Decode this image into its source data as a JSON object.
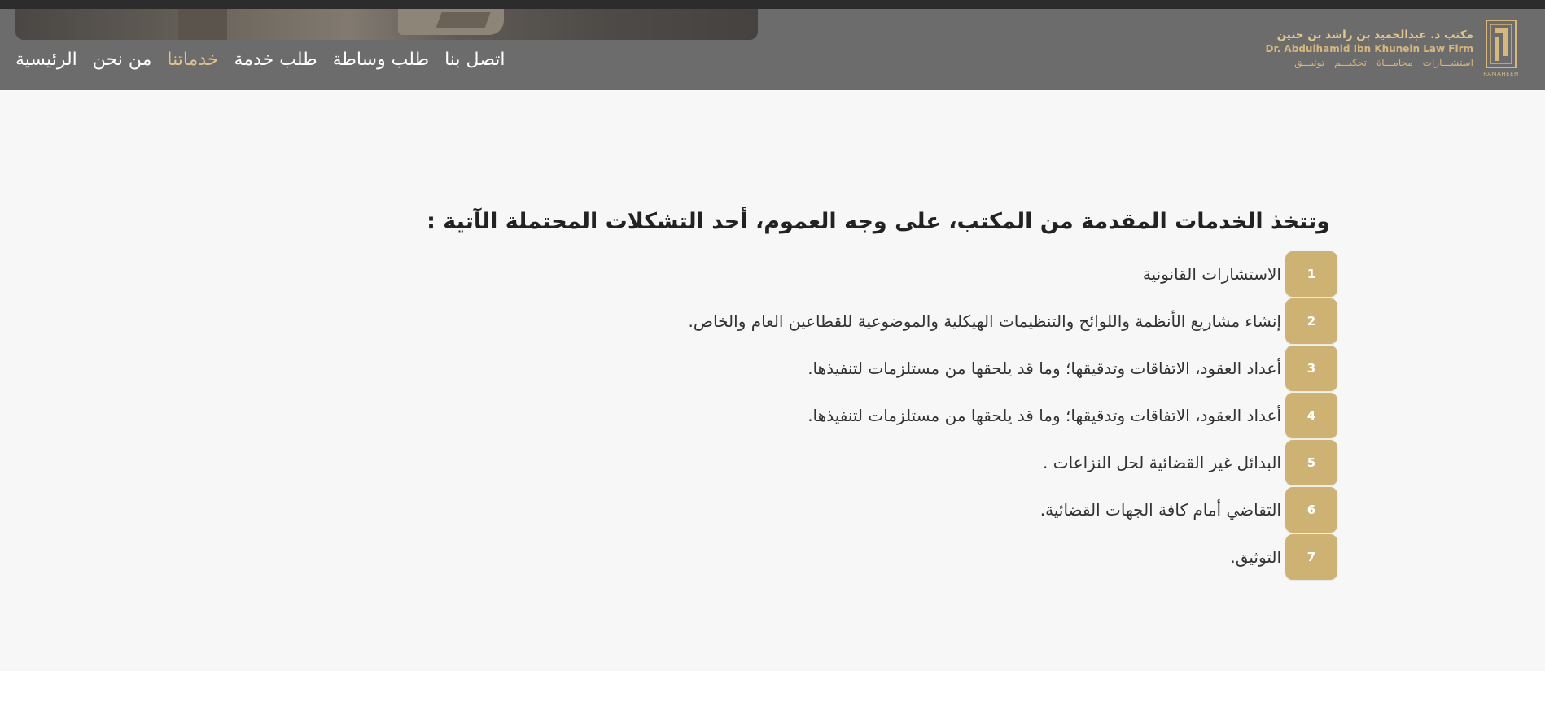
{
  "colors": {
    "header_bg": "#6c6c6c",
    "accent_gold": "#cdb273",
    "active_nav": "#e0c28a",
    "page_bg": "#f7f7f7"
  },
  "brand": {
    "line1": "مكتب د. عبدالحميد بن راشد بن خنين",
    "line2": "Dr. Abdulhamid Ibn Khunein Law Firm",
    "line3": "استشـــارات - محامـــاة - تحكيـــم - توثيـــق",
    "logo_caption": "RAMAHEEN",
    "logo_icon": "law-firm-logo-icon"
  },
  "nav": {
    "items": [
      {
        "label": "الرئيسية",
        "active": false
      },
      {
        "label": "من نحن",
        "active": false
      },
      {
        "label": "خدماتنا",
        "active": true
      },
      {
        "label": "طلب خدمة",
        "active": false
      },
      {
        "label": "طلب وساطة",
        "active": false
      },
      {
        "label": "اتصل بنا",
        "active": false
      }
    ]
  },
  "main": {
    "heading": "وتتخذ الخدمات المقدمة من المكتب، على وجه العموم، أحد التشكلات المحتملة الآتية :",
    "services": [
      {
        "number": "1",
        "text": "الاستشارات القانونية"
      },
      {
        "number": "2",
        "text": "إنشاء مشاريع الأنظمة واللوائح والتنظيمات الهيكلية والموضوعية للقطاعين العام والخاص."
      },
      {
        "number": "3",
        "text": "أعداد العقود، الاتفاقات وتدقيقها؛ وما قد يلحقها من مستلزمات لتنفيذها."
      },
      {
        "number": "4",
        "text": "أعداد العقود، الاتفاقات وتدقيقها؛ وما قد يلحقها من مستلزمات لتنفيذها."
      },
      {
        "number": "5",
        "text": "البدائل غير القضائية لحل النزاعات ."
      },
      {
        "number": "6",
        "text": "التقاضي أمام كافة الجهات القضائية."
      },
      {
        "number": "7",
        "text": "التوثيق."
      }
    ]
  }
}
